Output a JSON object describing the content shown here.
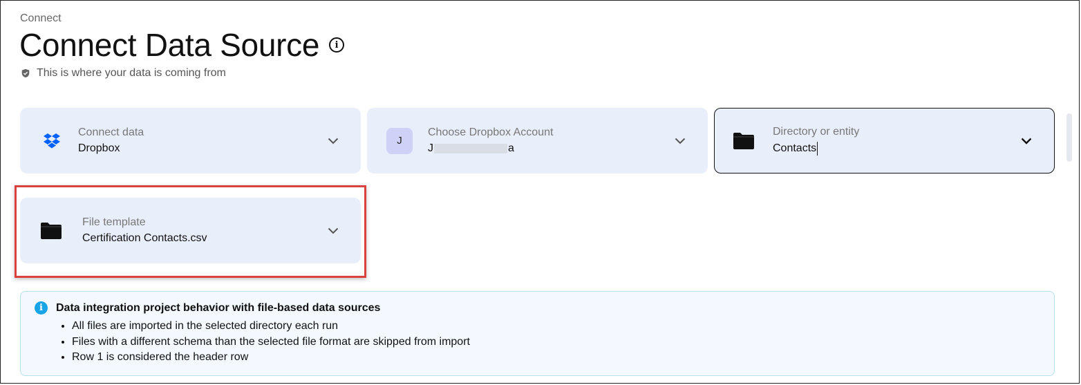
{
  "header": {
    "breadcrumb": "Connect",
    "title": "Connect Data Source",
    "subtitle": "This is where your data is coming from"
  },
  "cards": {
    "connect_data": {
      "label": "Connect data",
      "value": "Dropbox"
    },
    "account": {
      "label": "Choose Dropbox Account",
      "avatar": "J",
      "value_start": "J",
      "value_end": "a"
    },
    "directory": {
      "label": "Directory or entity",
      "value": "Contacts"
    },
    "file_template": {
      "label": "File template",
      "value": "Certification Contacts.csv"
    }
  },
  "notice": {
    "title": "Data integration project behavior with file-based data sources",
    "items": [
      "All files are imported in the selected directory each run",
      "Files with a different schema than the selected file format are skipped from import",
      "Row 1 is considered the header row"
    ]
  },
  "colors": {
    "card_bg": "#e9eefb",
    "highlight": "#d9423e",
    "info_accent": "#1aa4e8",
    "dropbox_blue": "#0061fe"
  }
}
